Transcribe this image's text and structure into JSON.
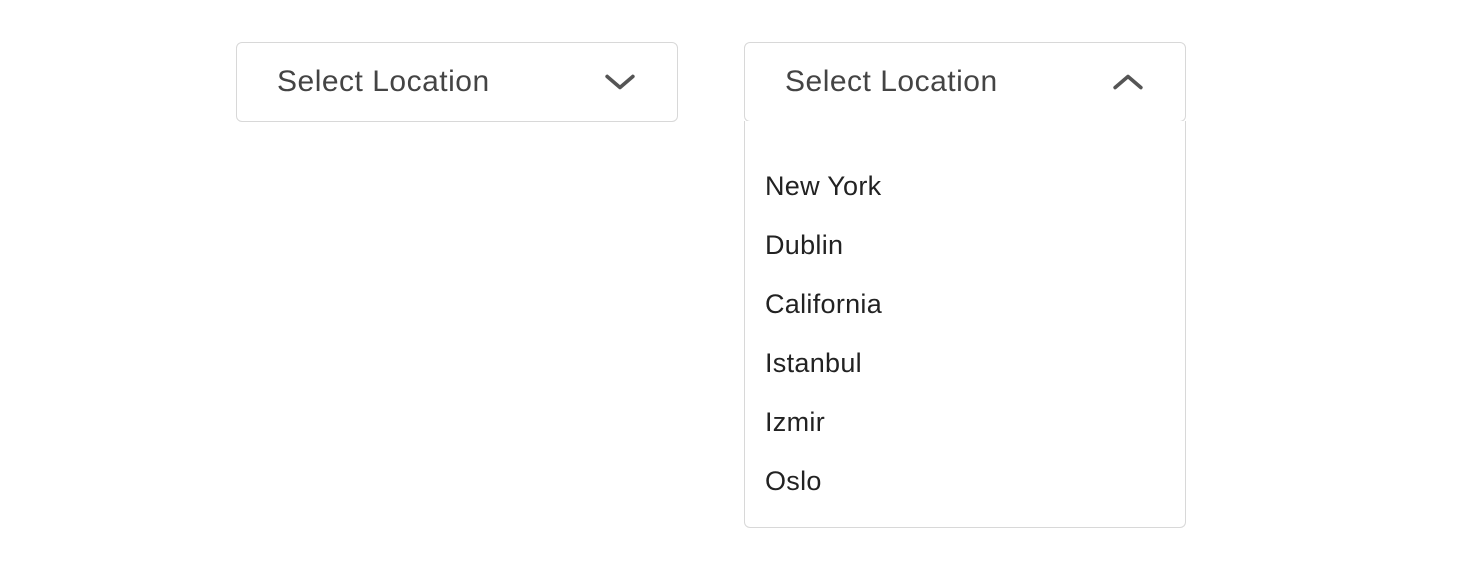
{
  "dropdowns": {
    "closed": {
      "label": "Select Location"
    },
    "open": {
      "label": "Select Location",
      "options": [
        "New York",
        "Dublin",
        "California",
        "Istanbul",
        "Izmir",
        "Oslo"
      ]
    }
  }
}
